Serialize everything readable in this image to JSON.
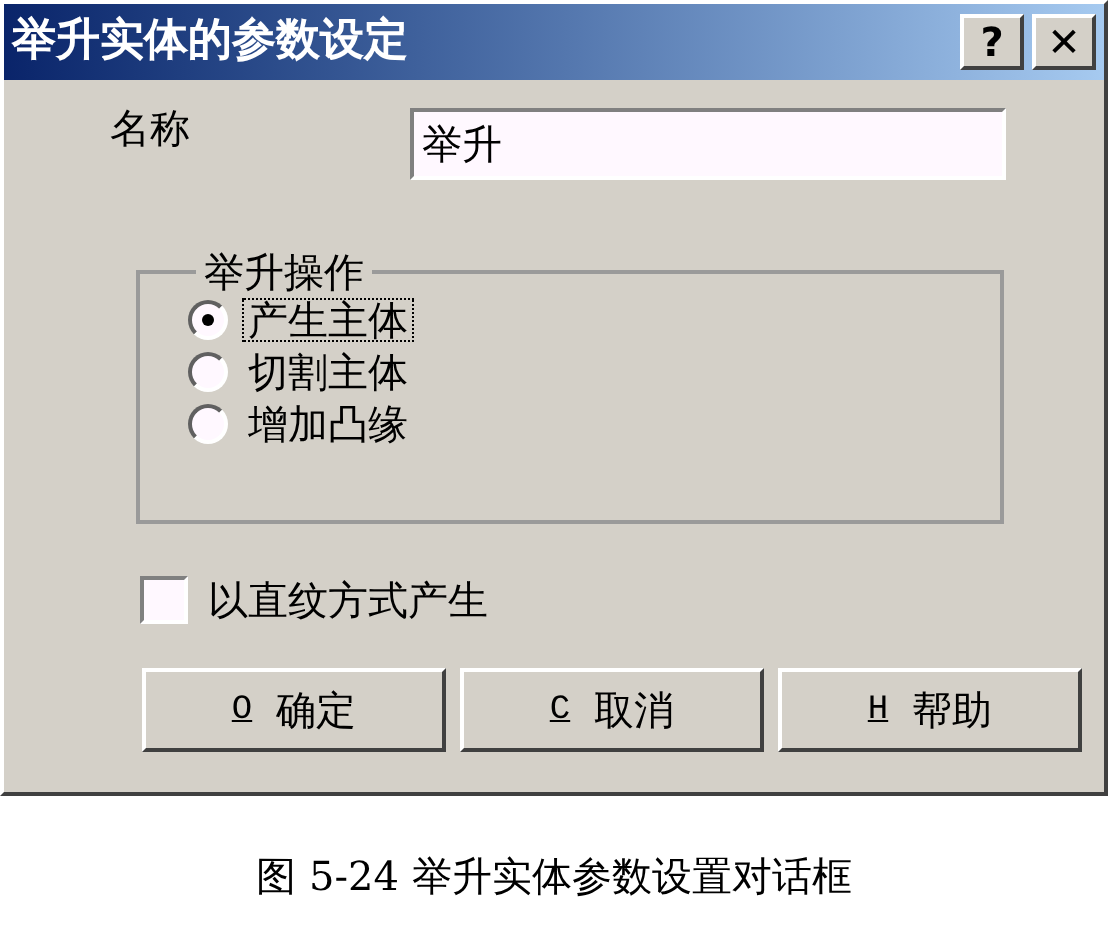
{
  "window": {
    "title": "举升实体的参数设定",
    "title_buttons": [
      {
        "label": "?"
      },
      {
        "label": "✕"
      }
    ]
  },
  "name_field": {
    "label": "名称",
    "value": "举升"
  },
  "operation_group": {
    "title": "举升操作",
    "options": [
      {
        "label": "产生主体",
        "selected": true
      },
      {
        "label": "切割主体",
        "selected": false
      },
      {
        "label": "增加凸缘",
        "selected": false
      }
    ]
  },
  "ruled_option": {
    "label": "以直纹方式产生",
    "checked": false
  },
  "buttons": [
    {
      "mnemonic": "O",
      "label": "确定"
    },
    {
      "mnemonic": "C",
      "label": "取消"
    },
    {
      "mnemonic": "H",
      "label": "帮助"
    }
  ],
  "caption": "图 5-24 举升实体参数设置对话框"
}
